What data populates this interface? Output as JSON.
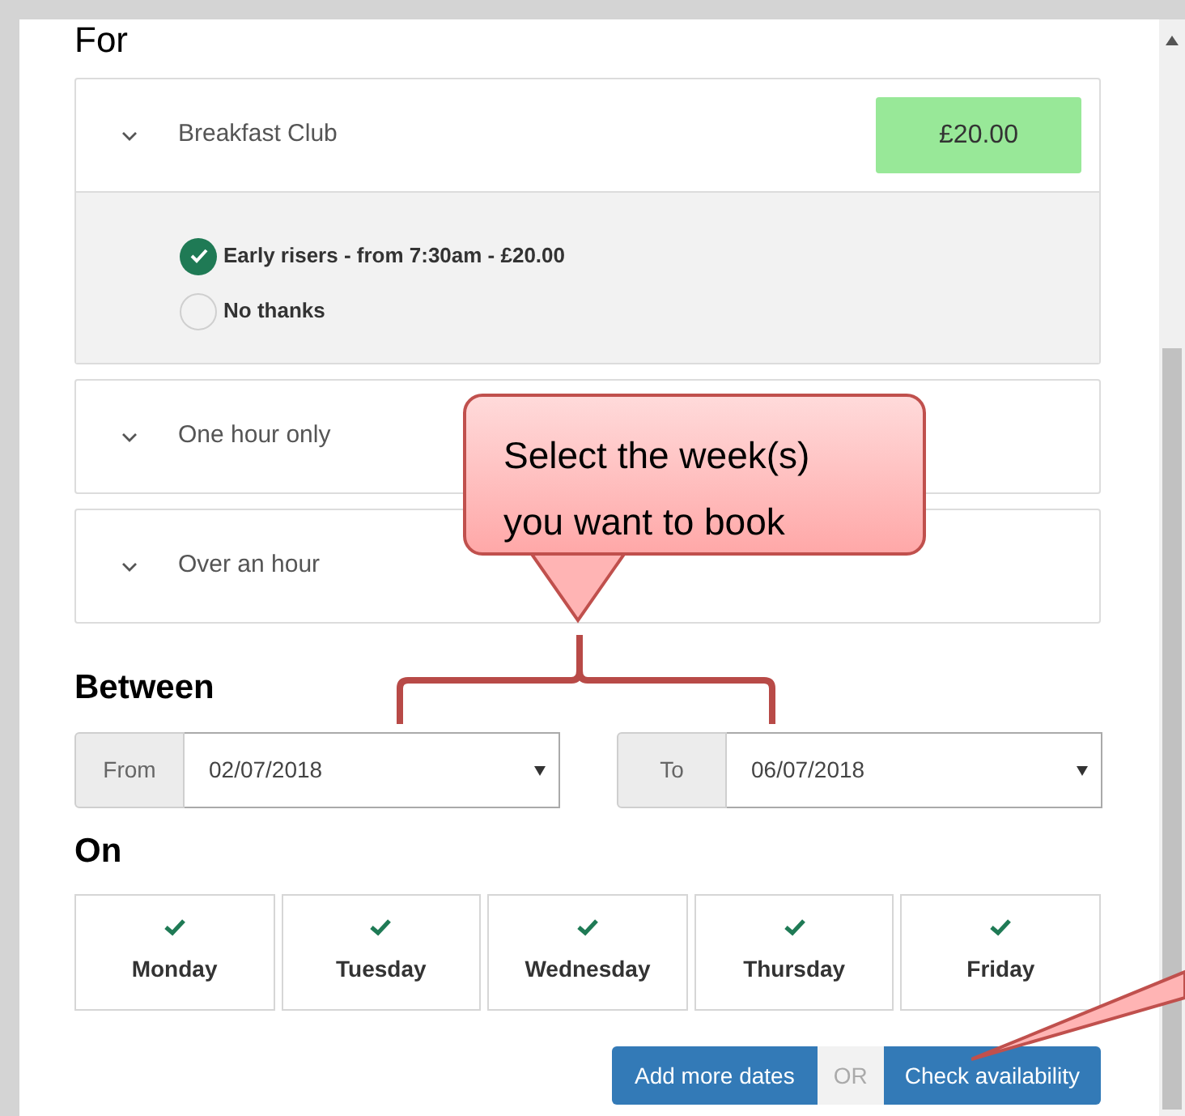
{
  "section_heading": "For",
  "options": [
    {
      "label": "Breakfast Club",
      "price": "£20.00",
      "choices": [
        {
          "label": "Early risers - from 7:30am - £20.00",
          "selected": true
        },
        {
          "label": "No thanks",
          "selected": false
        }
      ]
    },
    {
      "label": "One hour only"
    },
    {
      "label": "Over an hour"
    }
  ],
  "between": {
    "heading": "Between",
    "from": {
      "label": "From",
      "value": "02/07/2018"
    },
    "to": {
      "label": "To",
      "value": "06/07/2018"
    }
  },
  "on": {
    "heading": "On",
    "days": [
      {
        "label": "Monday",
        "checked": true
      },
      {
        "label": "Tuesday",
        "checked": true
      },
      {
        "label": "Wednesday",
        "checked": true
      },
      {
        "label": "Thursday",
        "checked": true
      },
      {
        "label": "Friday",
        "checked": true
      }
    ]
  },
  "buttons": {
    "add": "Add more dates",
    "separator": "OR",
    "check": "Check availability"
  },
  "callout": {
    "text": "Select the week(s) you want to book"
  }
}
